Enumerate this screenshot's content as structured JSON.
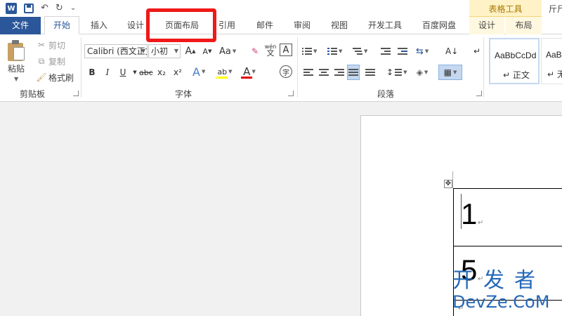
{
  "app": {
    "logo_letter": "W",
    "window_title": "斤斤",
    "context_tools_label": "表格工具"
  },
  "qat": {
    "undo_glyph": "↶",
    "redo_glyph": "↻",
    "customize_glyph": "⌄"
  },
  "tabs": [
    {
      "label": "文件"
    },
    {
      "label": "开始"
    },
    {
      "label": "插入"
    },
    {
      "label": "设计"
    },
    {
      "label": "页面布局"
    },
    {
      "label": "引用"
    },
    {
      "label": "邮件"
    },
    {
      "label": "审阅"
    },
    {
      "label": "视图"
    },
    {
      "label": "开发工具"
    },
    {
      "label": "百度网盘"
    },
    {
      "label": "设计"
    },
    {
      "label": "布局"
    }
  ],
  "clipboard": {
    "paste_label": "粘贴",
    "cut_label": "剪切",
    "copy_label": "复制",
    "format_painter_label": "格式刷",
    "group_label": "剪贴板"
  },
  "font": {
    "font_name": "Calibri (西文正文)",
    "font_size": "小初",
    "grow_label": "A",
    "shrink_label": "A",
    "case_label": "Aa",
    "phonetic_label": "wén",
    "border_char_label": "A",
    "bold": "B",
    "italic": "I",
    "underline": "U",
    "strikethrough": "abc",
    "subscript": "x₂",
    "superscript": "x²",
    "text_effect": "A",
    "highlight": "ab",
    "font_color": "A",
    "enclose_char": "字",
    "group_label": "字体",
    "highlight_color": "#ffff00",
    "font_color_value": "#e00000"
  },
  "paragraph": {
    "group_label": "段落"
  },
  "styles": {
    "items": [
      {
        "sample": "AaBbCcDd",
        "name": "正文"
      },
      {
        "sample": "AaBb",
        "name": "无"
      }
    ]
  },
  "document": {
    "cells": [
      "1",
      "5"
    ]
  },
  "watermark": {
    "top": "开发者",
    "bottom": "DevZe.CoM"
  },
  "colors": {
    "brand_blue": "#2b579a",
    "highlight_border": "#f01818"
  }
}
